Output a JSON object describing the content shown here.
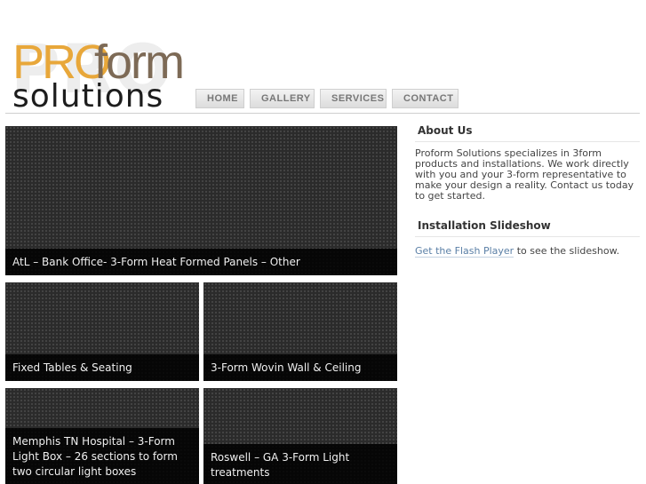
{
  "logo": {
    "ghost": "PRO",
    "pro": "PRO",
    "form": "form",
    "solutions": "solutions",
    "colors": {
      "pro": "#e8a73a",
      "form": "#7d6a56",
      "solutions": "#1d1d1d"
    }
  },
  "nav": {
    "items": [
      "HOME",
      "GALLERY",
      "SERVICES",
      "CONTACT"
    ]
  },
  "gallery": {
    "tiles": [
      {
        "caption": "AtL – Bank Office- 3-Form Heat Formed Panels – Other"
      },
      {
        "caption": "Fixed Tables & Seating"
      },
      {
        "caption": "3-Form Wovin Wall & Ceiling"
      },
      {
        "caption": "Memphis TN Hospital – 3-Form Light Box – 26 sections to form two circular light boxes"
      },
      {
        "caption": "Roswell – GA 3-Form Light treatments"
      }
    ]
  },
  "sidebar": {
    "about": {
      "heading": "About Us",
      "text": "Proform Solutions specializes in 3form products and installations. We work directly with you and your 3-form representative to make your design a reality. Contact us today to get started."
    },
    "slideshow": {
      "heading": "Installation Slideshow",
      "link": "Get the Flash Player",
      "text": " to see the slideshow."
    }
  }
}
